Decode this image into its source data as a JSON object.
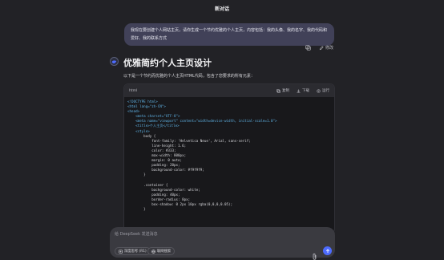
{
  "header": {
    "title": "新对话"
  },
  "user_message": {
    "text": "我现在要创建个人网站主页，请你生成一个节约优雅的个人主页，内容包括：我的头像、我的名字、我的代码和爱好、我的联系方式"
  },
  "message_actions": {
    "copy_icon": "copy-icon",
    "edit_label": "修改"
  },
  "assistant": {
    "title": "优雅简约个人主页设计",
    "intro": "以下是一个节约而优雅的个人主页HTML代码，包含了您要求的所有元素：",
    "code_block": {
      "language": "html",
      "copy_label": "复制",
      "download_label": "下载",
      "run_label": "运行",
      "lines": [
        {
          "cls": "tg",
          "text": "<!DOCTYPE html>"
        },
        {
          "cls": "tg",
          "text": "<html lang=\"zh-CN\">"
        },
        {
          "cls": "tg",
          "text": "<head>"
        },
        {
          "cls": "tg",
          "text": "    <meta charset=\"UTF-8\">"
        },
        {
          "cls": "tg",
          "text": "    <meta name=\"viewport\" content=\"width=device-width, initial-scale=1.0\">"
        },
        {
          "cls": "tg",
          "text": "    <title>个人主页</title>"
        },
        {
          "cls": "tg",
          "text": "    <style>"
        },
        {
          "cls": "tx",
          "text": "        body {"
        },
        {
          "cls": "tx",
          "text": "            font-family: 'Helvetica Neue', Arial, sans-serif;"
        },
        {
          "cls": "tx",
          "text": "            line-height: 1.6;"
        },
        {
          "cls": "tx",
          "text": "            color: #333;"
        },
        {
          "cls": "tx",
          "text": "            max-width: 800px;"
        },
        {
          "cls": "tx",
          "text": "            margin: 0 auto;"
        },
        {
          "cls": "tx",
          "text": "            padding: 20px;"
        },
        {
          "cls": "tx",
          "text": "            background-color: #f9f9f9;"
        },
        {
          "cls": "tx",
          "text": "        }"
        },
        {
          "cls": "tx",
          "text": ""
        },
        {
          "cls": "tx",
          "text": "        .container {"
        },
        {
          "cls": "tx",
          "text": "            background-color: white;"
        },
        {
          "cls": "tx",
          "text": "            padding: 40px;"
        },
        {
          "cls": "tx",
          "text": "            border-radius: 8px;"
        },
        {
          "cls": "tx",
          "text": "            box-shadow: 0 2px 10px rgba(0,0,0,0.05);"
        },
        {
          "cls": "tx",
          "text": "        }"
        }
      ]
    }
  },
  "composer": {
    "placeholder": "给 DeepSeek 发送消息",
    "deep_think_label": "深度思考 (R1)",
    "web_search_label": "联网搜索",
    "attach_icon": "paperclip-icon",
    "send_icon": "send-arrow-icon",
    "accent_color": "#4d6bfe"
  }
}
